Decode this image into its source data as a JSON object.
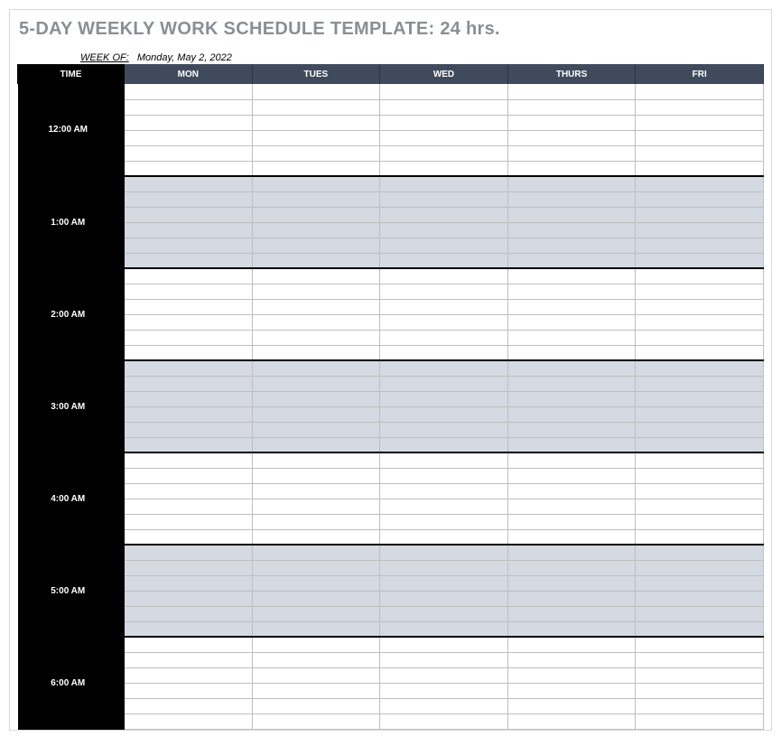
{
  "title": "5-DAY WEEKLY WORK SCHEDULE TEMPLATE: 24 hrs.",
  "week_of_label": "WEEK OF:",
  "week_of_value": "Monday, May 2, 2022",
  "columns": {
    "time": "TIME",
    "mon": "MON",
    "tues": "TUES",
    "wed": "WED",
    "thurs": "THURS",
    "fri": "FRI"
  },
  "hours": [
    {
      "label": "12:00 AM",
      "shaded": false
    },
    {
      "label": "1:00 AM",
      "shaded": true
    },
    {
      "label": "2:00 AM",
      "shaded": false
    },
    {
      "label": "3:00 AM",
      "shaded": true
    },
    {
      "label": "4:00 AM",
      "shaded": false
    },
    {
      "label": "5:00 AM",
      "shaded": true
    },
    {
      "label": "6:00 AM",
      "shaded": false
    }
  ],
  "slots_per_hour": 6
}
